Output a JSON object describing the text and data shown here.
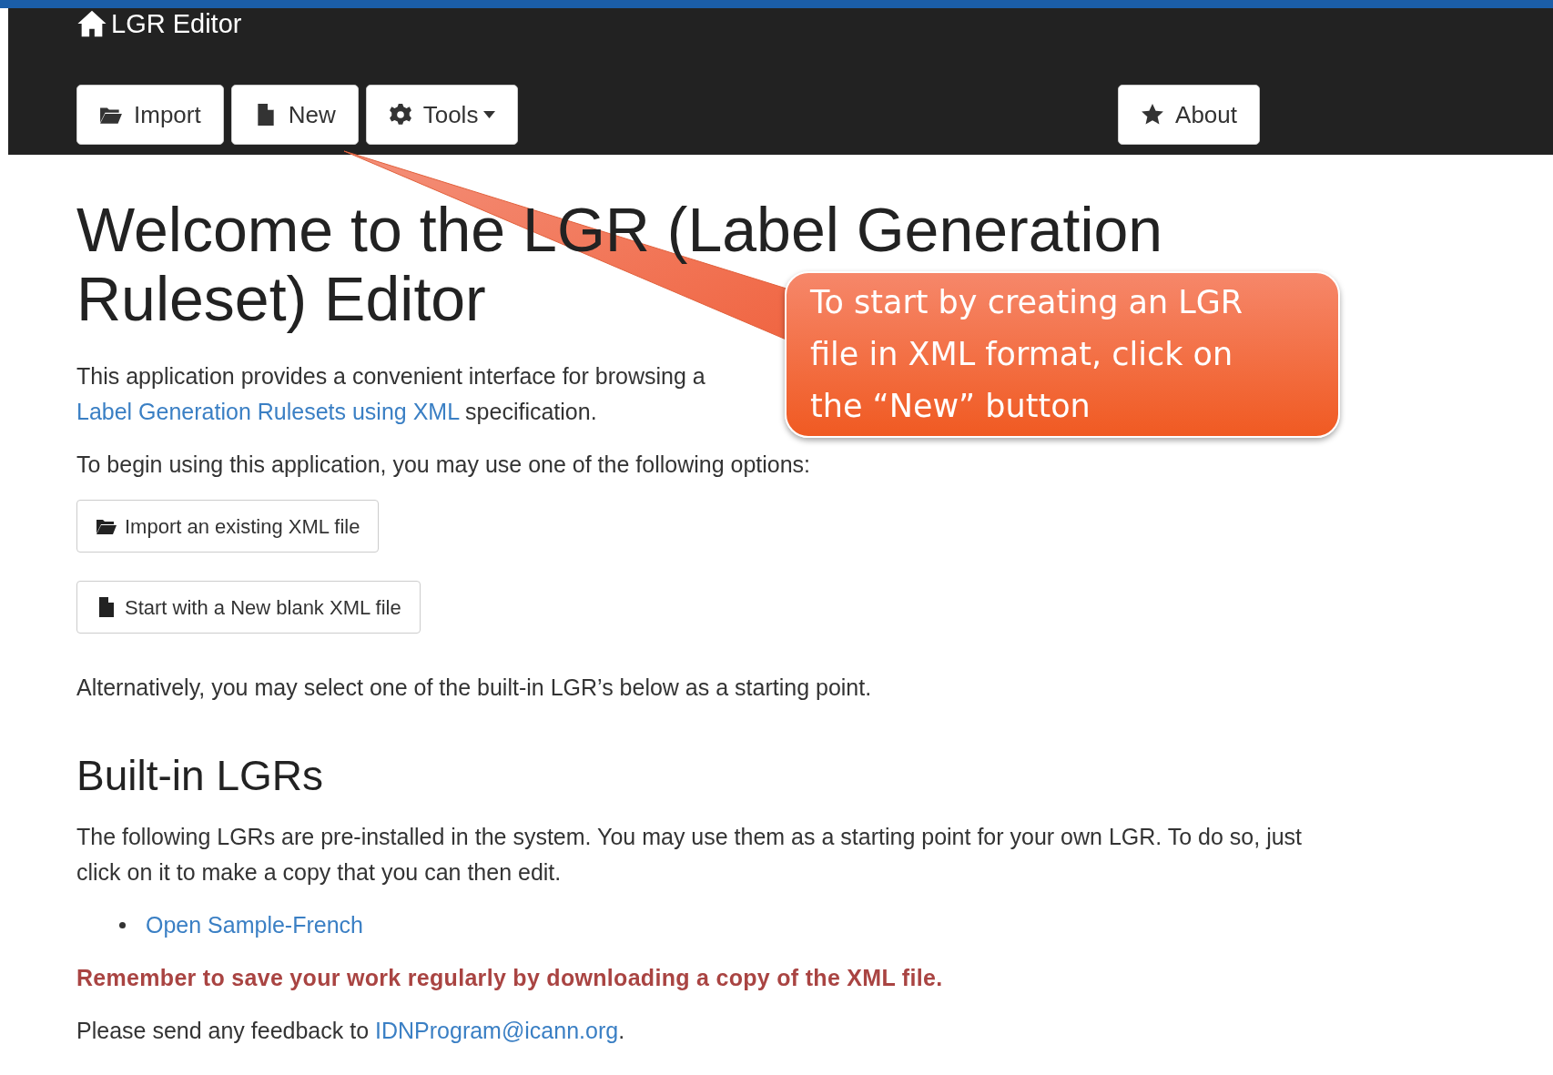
{
  "brand": {
    "label": "LGR Editor"
  },
  "nav_buttons": [
    {
      "label": "Import",
      "kind": "import"
    },
    {
      "label": "New",
      "kind": "new"
    },
    {
      "label": "Tools",
      "kind": "tools"
    },
    {
      "label": "About",
      "kind": "about"
    }
  ],
  "title_lines": [
    "Welcome to the LGR (Label Generation",
    "Ruleset) Editor"
  ],
  "intro": {
    "text": "This application provides a convenient interface for browsing a",
    "link": "Label Generation Rulesets using XML",
    "suffix": " specification."
  },
  "options_text": "To begin using this application, you may use one of the following options:",
  "option_buttons": [
    {
      "label": "Import an existing XML file",
      "kind": "import"
    },
    {
      "label": "Start with a New blank XML file",
      "kind": "new"
    }
  ],
  "alternative_text": "Alternatively, you may select one of the built-in LGR’s below as a starting point.",
  "builtin": {
    "heading": "Built-in LGRs",
    "text": "The following LGRs are pre-installed in the system. You may use them as a starting point for your own LGR. To do so, just click on it to make a copy that you can then edit.",
    "links": [
      "Open Sample-French"
    ]
  },
  "warning": "Remember to save your work regularly by downloading a copy of the XML file.",
  "feedback": {
    "text": "Please send any feedback to ",
    "link": "IDNProgram@icann.org",
    "suffix": "."
  },
  "callout": {
    "text": "To start by creating an LGR file in XML format, click on the “New” button"
  }
}
